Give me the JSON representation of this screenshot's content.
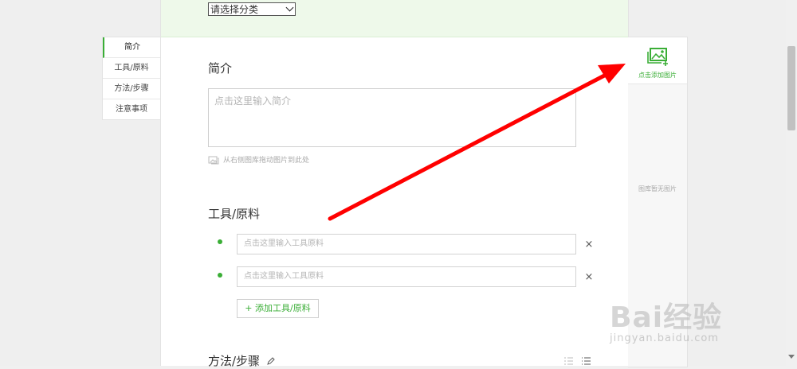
{
  "category_select": {
    "value": "请选择分类"
  },
  "left_nav": {
    "items": [
      {
        "label": "简介",
        "active": true
      },
      {
        "label": "工具/原料",
        "active": false
      },
      {
        "label": "方法/步骤",
        "active": false
      },
      {
        "label": "注意事项",
        "active": false
      }
    ]
  },
  "intro": {
    "title": "简介",
    "placeholder": "点击这里输入简介",
    "drag_hint": "从右侧图库拖动图片到此处"
  },
  "tools": {
    "title": "工具/原料",
    "inputs": [
      {
        "placeholder": "点击这里输入工具原料"
      },
      {
        "placeholder": "点击这里输入工具原料"
      }
    ],
    "remove_label": "×",
    "add_button": "+ 添加工具/原料"
  },
  "steps": {
    "title": "方法/步骤"
  },
  "gallery": {
    "add_label": "点击添加图片",
    "empty_text": "图库暂无图片"
  },
  "watermark": {
    "brand": "Bai经验",
    "url": "jingyan.baidu.com"
  },
  "colors": {
    "accent": "#3aae36",
    "arrow": "#ff0000",
    "top_band": "#eef9ea"
  },
  "icons": [
    "chevron-down-icon",
    "image-icon",
    "add-image-icon",
    "close-icon",
    "pencil-icon",
    "ordered-list-icon",
    "unordered-list-icon",
    "arrow-annotation"
  ]
}
